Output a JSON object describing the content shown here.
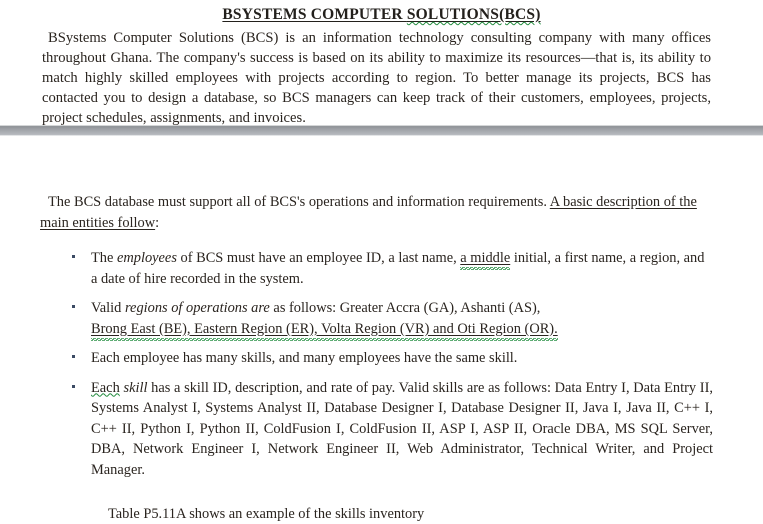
{
  "document": {
    "title": {
      "prefix": "BSYSTEMS COMPUTER ",
      "misspelled": "SOLUTIONS(BCS)",
      "full": "BSYSTEMS COMPUTER SOLUTIONS(BCS)"
    },
    "intro_paragraph": "BSystems Computer Solutions (BCS) is an information technology consulting company with many offices throughout Ghana. The company's  success is based on its ability to maximize its resources—that is, its ability to match highly skilled employees with projects according to region. To better manage its projects, BCS has contacted you to design a database, so BCS managers can keep track of their customers, employees, projects, project schedules, assignments, and invoices.",
    "lead_paragraph": {
      "plain": "The BCS database must support all of BCS's operations and information requirements. ",
      "underlined": "A basic description of the main entities follow",
      "tail": ":"
    },
    "bullets": [
      {
        "id": "employees",
        "segments": [
          {
            "text": "The ",
            "style": "normal"
          },
          {
            "text": "employees",
            "style": "italic"
          },
          {
            "text": "  of BCS  must have an employee ID, a last name, ",
            "style": "normal"
          },
          {
            "text": "a middle",
            "style": "squiggle"
          },
          {
            "text": " initial, a first name, a region, and a date of hire recorded in the system.",
            "style": "normal"
          }
        ]
      },
      {
        "id": "regions",
        "segments": [
          {
            "text": "Valid ",
            "style": "normal"
          },
          {
            "text": "regions  of operations  are",
            "style": "italic"
          },
          {
            "text": " as follows:  Greater Accra (GA), Ashanti (AS), ",
            "style": "normal"
          },
          {
            "text": "Brong East (BE), Eastern Region (ER),  Volta Region (VR) and Oti Region (OR).",
            "style": "underline-squiggle"
          }
        ]
      },
      {
        "id": "employee-skills",
        "segments": [
          {
            "text": "Each employee has many skills,  and many employees  have the same skill.",
            "style": "normal"
          }
        ]
      },
      {
        "id": "skills",
        "segments": [
          {
            "text": "Each",
            "style": "squiggle"
          },
          {
            "text": " ",
            "style": "normal"
          },
          {
            "text": "skill",
            "style": "italic"
          },
          {
            "text": " has a skill ID, description,  and  rate of pay. Valid skills are as follows: Data Entry I, Data Entry II, Systems Analyst I, Systems Analyst II, Database Designer I, Database Designer II, Java I, Java II, C++ I, C++ II, Python I, Python II, ColdFusion I, ColdFusion II, ASP I, ASP II, Oracle DBA, MS SQL Server, DBA,  Network Engineer I, Network Engineer II, Web Administrator,  Technical Writer, and Project Manager.",
            "style": "normal"
          }
        ]
      }
    ],
    "footer_note": "Table P5.11A shows an example of the skills inventory"
  },
  "colors": {
    "text": "#2a241f",
    "spellcheck_squiggle": "#1f8a3b",
    "separator_dark": "#8e9196",
    "separator_light": "#b6b9be",
    "page_background": "#ffffff"
  }
}
